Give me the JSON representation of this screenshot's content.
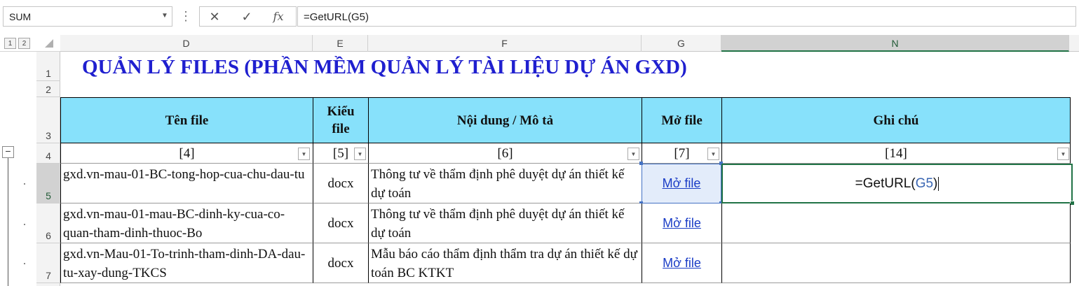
{
  "formula_bar": {
    "name_box": "SUM",
    "cancel_icon": "✕",
    "enter_icon": "✓",
    "fx_label": "fx",
    "formula": "=GetURL(G5)"
  },
  "outline_levels": [
    "1",
    "2"
  ],
  "outline_collapse": "−",
  "columns": [
    "D",
    "E",
    "F",
    "G",
    "N"
  ],
  "selected_column": "N",
  "rows": [
    "1",
    "2",
    "3",
    "4",
    "5",
    "6",
    "7"
  ],
  "selected_row": "5",
  "title": "QUẢN LÝ FILES (PHẦN MỀM QUẢN LÝ TÀI LIỆU DỰ ÁN GXD)",
  "table": {
    "headers": [
      "Tên file",
      "Kiểu file",
      "Nội dung / Mô tả",
      "Mở file",
      "Ghi chú"
    ],
    "codes": [
      "[4]",
      "[5]",
      "[6]",
      "[7]",
      "[14]"
    ],
    "records": [
      {
        "name": "gxd.vn-mau-01-BC-tong-hop-cua-chu-dau-tu",
        "type": "docx",
        "description": "Thông tư về thẩm định phê duyệt dự án thiết kế dự toán",
        "link": "Mở file"
      },
      {
        "name": "gxd.vn-mau-01-mau-BC-dinh-ky-cua-co-quan-tham-dinh-thuoc-Bo",
        "type": "docx",
        "description": "Thông tư về thẩm định phê duyệt dự án thiết kế dự toán",
        "link": "Mở file"
      },
      {
        "name": "gxd.vn-Mau-01-To-trinh-tham-dinh-DA-dau-tu-xay-dung-TKCS",
        "type": "docx",
        "description": "Mẫu báo cáo thẩm định thẩm tra dự án thiết kế dự toán BC KTKT",
        "link": "Mở file"
      }
    ]
  },
  "edit_cell": {
    "prefix": "=GetURL(",
    "ref": "G5",
    "suffix": ")"
  },
  "colors": {
    "header_fill": "#87e1fb",
    "title": "#1f1fcf",
    "link": "#1a3cc6",
    "excel_green": "#217346"
  }
}
